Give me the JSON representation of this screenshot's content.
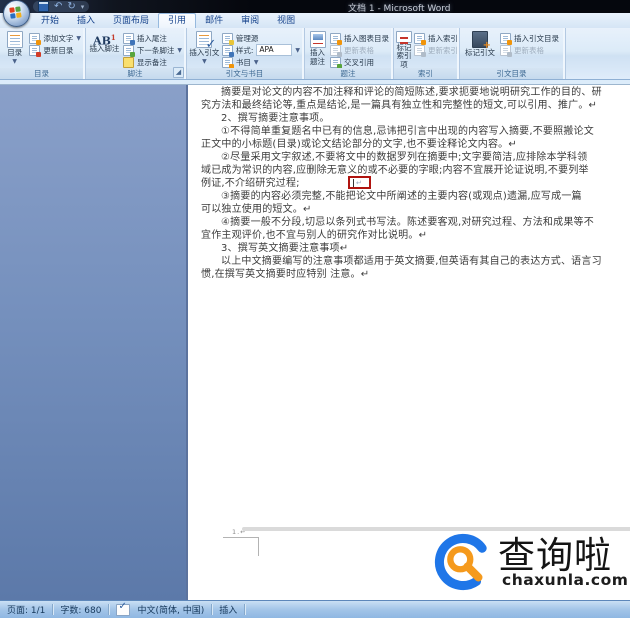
{
  "title_bar": {
    "title": "文档 1 - Microsoft Word"
  },
  "tabs": [
    "开始",
    "插入",
    "页面布局",
    "引用",
    "邮件",
    "审阅",
    "视图"
  ],
  "ribbon": {
    "toc_group": {
      "label": "目录",
      "toc": "目录",
      "add_text": "添加文字",
      "update_toc": "更新目录"
    },
    "footnote_group": {
      "label": "脚注",
      "ab_glyph": "AB",
      "insert_footnote": "插入脚注",
      "insert_endnote": "插入尾注",
      "next_footnote": "下一条脚注",
      "show_notes": "显示备注"
    },
    "citation_group": {
      "label": "引文与书目",
      "insert_citation": "插入引文",
      "manage_sources": "管理源",
      "style_label": "样式:",
      "style_value": "APA",
      "bibliography": "书目"
    },
    "caption_group": {
      "label": "题注",
      "insert_caption": "插入题注",
      "insert_tof": "插入图表目录",
      "update_table": "更新表格",
      "cross_reference": "交叉引用"
    },
    "index_group": {
      "label": "索引",
      "mark_entry_line1": "标记",
      "mark_entry_line2": "索引项",
      "insert_index": "插入索引",
      "update_index": "更新索引"
    },
    "toa_group": {
      "label": "引文目录",
      "mark_citation": "标记引文",
      "insert_toa": "插入引文目录",
      "update_table": "更新表格"
    }
  },
  "document": {
    "lines": [
      "摘要是对论文的内容不加注释和评论的简短陈述,要求扼要地说明研究工作的目的、研",
      "究方法和最终结论等,重点是结论,是一篇具有独立性和完整性的短文,可以引用、推广。↵",
      "2、撰写摘要注意事项。",
      "①不得简单重复题名中已有的信息,忌讳把引言中出现的内容写入摘要,不要照搬论文",
      "正文中的小标题(目录)或论文结论部分的文字,也不要诠释论文内容。↵",
      "②尽量采用文字叙述,不要将文中的数据罗列在摘要中;文字要简洁,应排除本学科领",
      "域已成为常识的内容,应删除无意义的或不必要的字眼;内容不宜展开论证说明,不要列举",
      "例证,不介绍研究过程;",
      "③摘要的内容必须完整,不能把论文中所阐述的主要内容(或观点)遗漏,应写成一篇",
      "可以独立使用的短文。↵",
      "④摘要一般不分段,切忌以条列式书写法。陈述要客观,对研究过程、方法和成果等不",
      "宜作主观评价,也不宜与别人的研究作对比说明。↵",
      "3、撰写英文摘要注意事项↵",
      "以上中文摘要编写的注意事项都适用于英文摘要,但英语有其自己的表达方式、语言习",
      "惯,在撰写英文摘要时应特别 注意。↵"
    ],
    "cursor_mark": "↵",
    "footer_page_mark": "1.↵"
  },
  "status_bar": {
    "page": "页面: 1/1",
    "words": "字数: 680",
    "language": "中文(简体, 中国)",
    "mode": "插入"
  },
  "watermark": {
    "brand": "查询啦",
    "domain": "chaxunla.com"
  },
  "colors": {
    "accent_blue": "#1f76e8",
    "accent_orange": "#f59a1d",
    "annotation_red": "#b01410"
  }
}
